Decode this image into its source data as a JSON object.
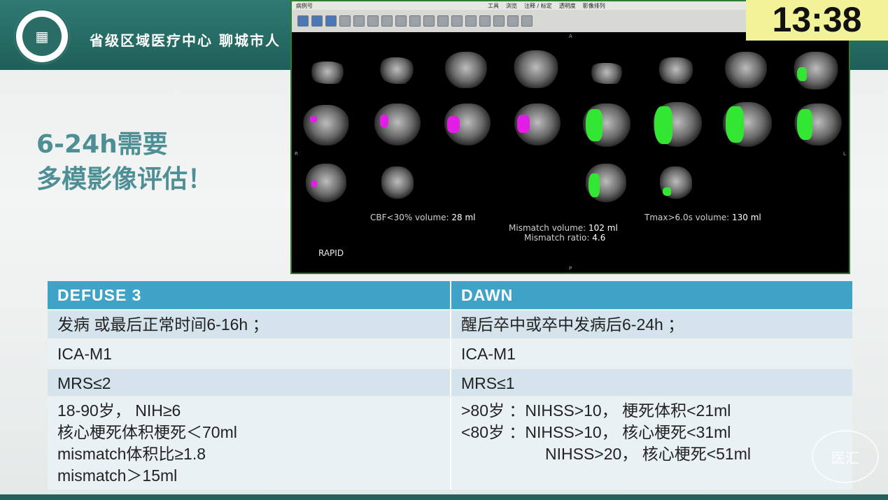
{
  "header": {
    "title": "省级区域医疗中心   聊城市人"
  },
  "slide": {
    "heading_line1": "6-24h需要",
    "heading_line2": "多模影像评估！"
  },
  "clock": {
    "time": "13:38"
  },
  "viewer": {
    "menu": [
      "病例号",
      "工具",
      "浏览",
      "注释 / 标定",
      "透明度",
      "影像排列"
    ],
    "cbf_label": "CBF<30% volume:",
    "cbf_value": "28 ml",
    "tmax_label": "Tmax>6.0s volume:",
    "tmax_value": "130 ml",
    "mismatch_volume_label": "Mismatch volume:",
    "mismatch_volume_value": "102 ml",
    "mismatch_ratio_label": "Mismatch ratio:",
    "mismatch_ratio_value": "4.6",
    "software": "RAPID",
    "marker_a": "A",
    "marker_p": "P",
    "marker_r": "R",
    "marker_l": "L",
    "colors": {
      "core": "#e21de6",
      "hypoperfusion": "#33e633",
      "border": "#2e7d32"
    }
  },
  "table": {
    "headers": [
      "DEFUSE 3",
      "DAWN"
    ],
    "rows": [
      [
        "发病 或最后正常时间6-16h ；",
        "醒后卒中或卒中发病后6-24h ；"
      ],
      [
        "ICA-M1",
        "ICA-M1"
      ],
      [
        "MRS≤2",
        "MRS≤1"
      ]
    ],
    "criteria_left": [
      "18-90岁， NIH≥6",
      "核心梗死体积梗死＜70ml",
      "mismatch体积比≥1.8",
      "mismatch＞15ml"
    ],
    "criteria_right": [
      ">80岁 ：NIHSS>10， 梗死体积<21ml",
      "<80岁 ：NIHSS>10， 核心梗死<31ml",
      "NIHSS>20， 核心梗死<51ml"
    ],
    "colors": {
      "header_bg": "#3fa3c7",
      "row_dark": "#d5e4ec",
      "row_light": "#eaf1f5"
    }
  },
  "watermark": "医汇"
}
